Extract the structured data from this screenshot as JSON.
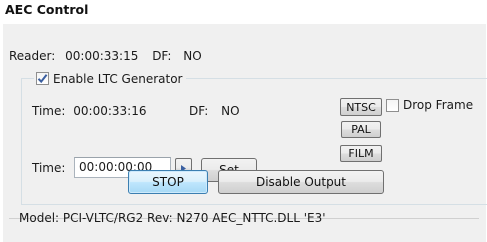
{
  "title": "AEC Control",
  "reader": {
    "label": "Reader:",
    "timecode": "00:00:33:15",
    "df_label": "DF:",
    "df_value": "NO"
  },
  "ltc": {
    "enable_label": "Enable LTC Generator",
    "enabled": true,
    "time_label": "Time:",
    "timecode": "00:00:33:16",
    "df_label": "DF:",
    "df_value": "NO",
    "set_time_label": "Time:",
    "set_time_value": "00:00:00:00",
    "set_button": "Set",
    "formats": [
      "NTSC",
      "PAL",
      "FILM"
    ],
    "drop_frame_label": "Drop Frame",
    "drop_frame_checked": false
  },
  "buttons": {
    "stop": "STOP",
    "disable_output": "Disable Output"
  },
  "status": "Model: PCI-VLTC/RG2 Rev: N270 AEC_NTTC.DLL 'E3'",
  "icons": {
    "enable_checkbox": "checkmark-icon",
    "spin_arrow": "play-arrow-icon"
  },
  "colors": {
    "accent_blue": "#3c7fb1",
    "checkmark": "#3b5fa0"
  }
}
